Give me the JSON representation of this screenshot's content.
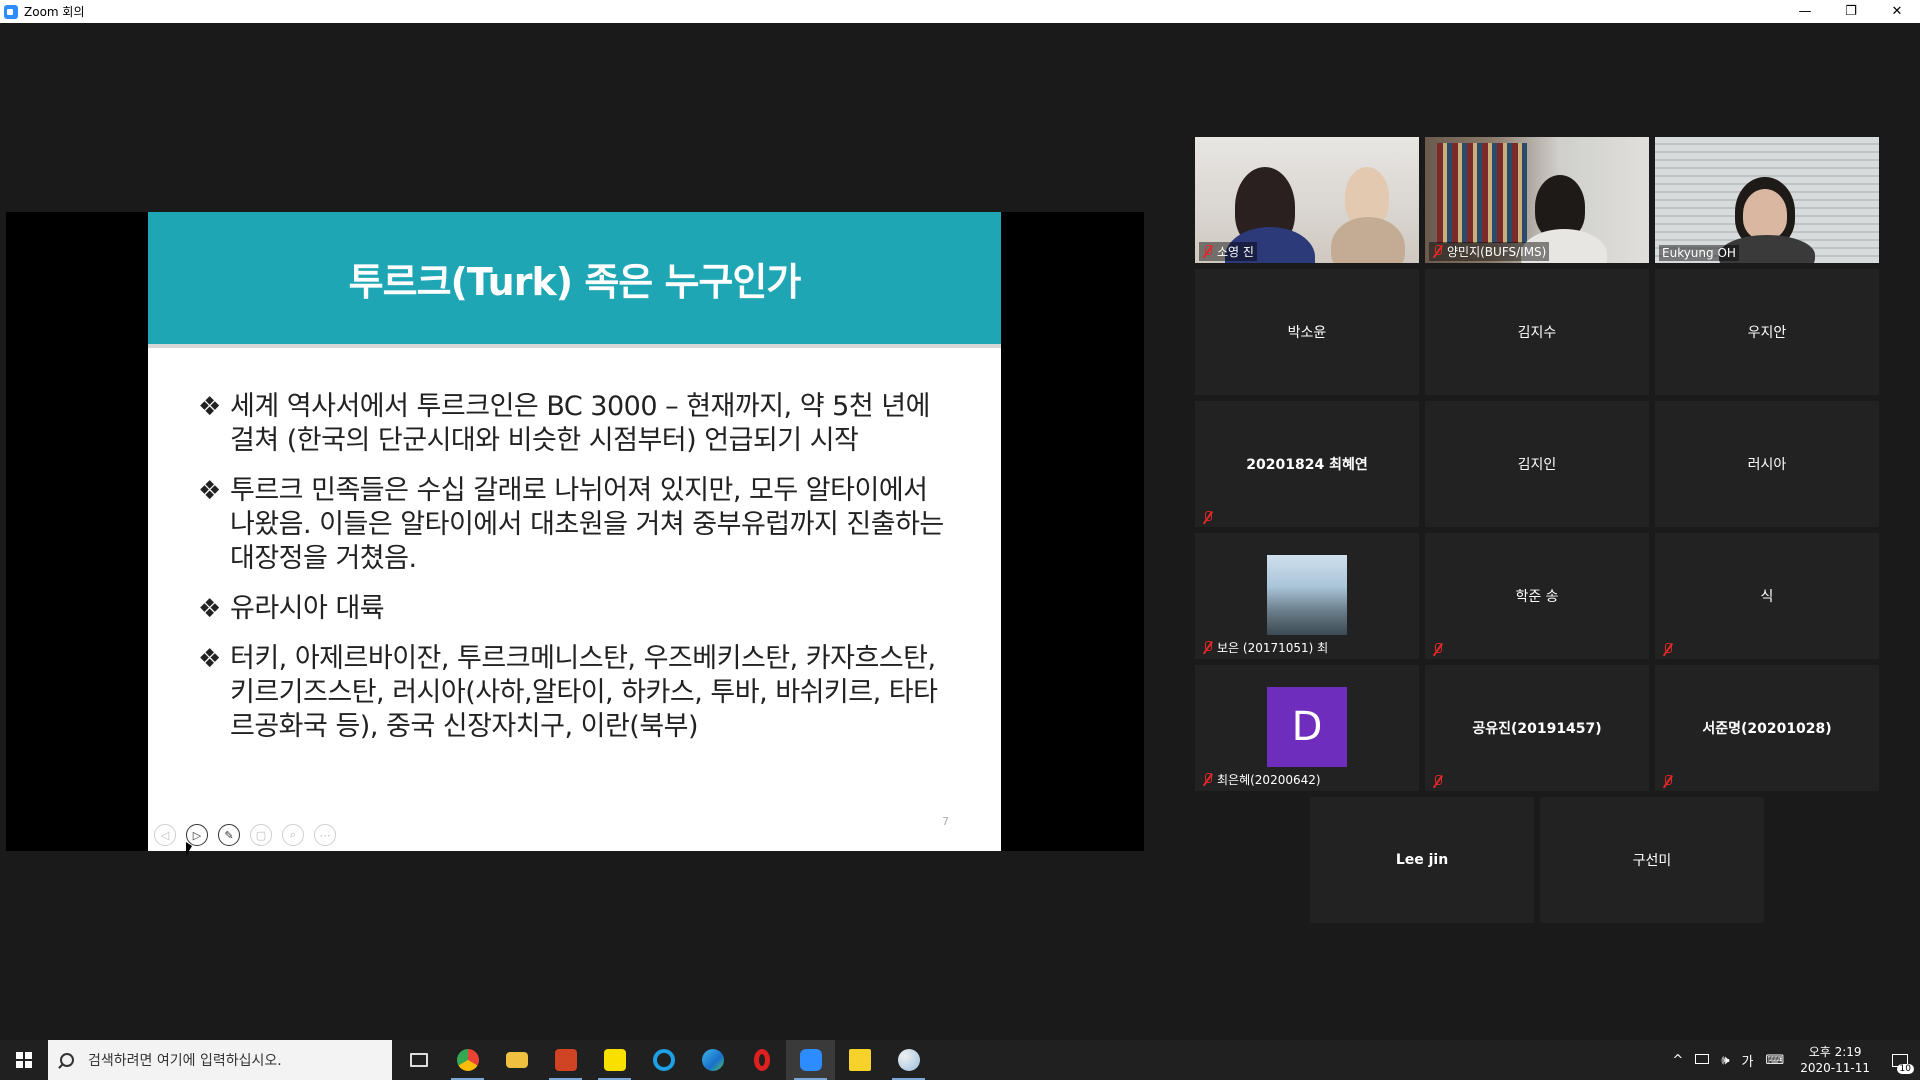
{
  "window": {
    "title": "Zoom 회의",
    "minimize": "—",
    "restore": "❐",
    "close": "✕"
  },
  "slide": {
    "title": "투르크(Turk) 족은 누구인가",
    "bullet_mark": "❖",
    "bullets": [
      "세계 역사서에서 투르크인은 BC 3000 – 현재까지, 약 5천 년에 걸쳐 (한국의 단군시대와 비슷한 시점부터) 언급되기 시작",
      "투르크 민족들은 수십 갈래로 나뉘어져 있지만, 모두 알타이에서 나왔음. 이들은 알타이에서 대초원을 거쳐 중부유럽까지 진출하는 대장정을 거쳤음.",
      "유라시아 대륙",
      "터키, 아제르바이잔, 투르크메니스탄, 우즈베키스탄, 카자흐스탄, 키르기즈스탄, 러시아(사하,알타이, 하카스, 투바, 바쉬키르, 타타르공화국 등), 중국 신장자치구, 이란(북부)"
    ],
    "page_number": "7",
    "toolbar": [
      "◁",
      "▷",
      "✎",
      "▢",
      "⌕",
      "⋯"
    ]
  },
  "participants": {
    "video": [
      {
        "name": "소영 진",
        "muted": true
      },
      {
        "name": "양민지(BUFS/IMS)",
        "muted": true
      },
      {
        "name": "Eukyung OH",
        "muted": false,
        "active_speaker": true
      }
    ],
    "tiles": [
      {
        "name": "박소윤",
        "muted": false
      },
      {
        "name": "김지수",
        "muted": false
      },
      {
        "name": "우지안",
        "muted": false
      },
      {
        "name": "20201824 최혜연",
        "muted": true
      },
      {
        "name": "김지인",
        "muted": false
      },
      {
        "name": "러시아",
        "muted": false
      },
      {
        "name": "보은 (20171051) 최",
        "muted": true,
        "avatar": "photo"
      },
      {
        "name": "학준 송",
        "muted": true
      },
      {
        "name": "식",
        "muted": true
      },
      {
        "name": "최은혜(20200642)",
        "muted": true,
        "avatar": "letter",
        "avatar_letter": "D"
      },
      {
        "name": "공유진(20191457)",
        "muted": true
      },
      {
        "name": "서준명(20201028)",
        "muted": true
      },
      {
        "name": "Lee jin",
        "muted": false
      },
      {
        "name": "구선미",
        "muted": false
      }
    ]
  },
  "taskbar": {
    "search_placeholder": "검색하려면 여기에 입력하십시오.",
    "apps": [
      "task-view",
      "chrome",
      "file-explorer",
      "powerpoint",
      "kakaotalk",
      "internet-explorer",
      "edge",
      "opera",
      "zoom",
      "sticky-notes",
      "paint"
    ],
    "tray": {
      "chevron": "^",
      "volume": "🕪",
      "ime": "가",
      "ime_mode": "⌨",
      "time": "오후 2:19",
      "date": "2020-11-11",
      "notifications": "10"
    }
  }
}
